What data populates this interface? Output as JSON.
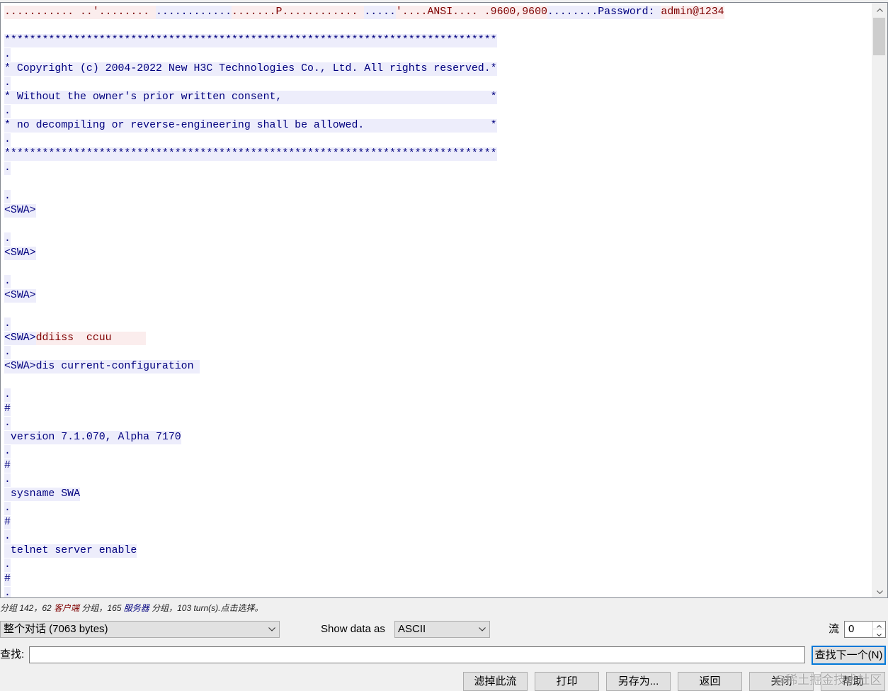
{
  "colors": {
    "client_text": "#7f0000",
    "client_bg": "#fbeded",
    "server_text": "#00007f",
    "server_bg": "#ededfb",
    "accent": "#0078d7"
  },
  "stream": {
    "lines": [
      [
        {
          "client": "........... ..'........ "
        },
        {
          "server": "............"
        },
        {
          "client": ".......P............ "
        },
        {
          "server": "....."
        },
        {
          "client": "'....ANSI.... .9600,9600"
        },
        {
          "server": "........Password: "
        },
        {
          "client": "admin@1234"
        }
      ],
      [],
      [
        {
          "server": "******************************************************************************"
        }
      ],
      [
        {
          "server": "."
        }
      ],
      [
        {
          "server": "* Copyright (c) 2004-2022 New H3C Technologies Co., Ltd. All rights reserved.*"
        }
      ],
      [
        {
          "server": "."
        }
      ],
      [
        {
          "server": "* Without the owner's prior written consent,                                 *"
        }
      ],
      [
        {
          "server": "."
        }
      ],
      [
        {
          "server": "* no decompiling or reverse-engineering shall be allowed.                    *"
        }
      ],
      [
        {
          "server": "."
        }
      ],
      [
        {
          "server": "******************************************************************************"
        }
      ],
      [
        {
          "server": "."
        }
      ],
      [],
      [
        {
          "server": "."
        }
      ],
      [
        {
          "server": "<SWA>"
        }
      ],
      [],
      [
        {
          "server": "."
        }
      ],
      [
        {
          "server": "<SWA>"
        }
      ],
      [],
      [
        {
          "server": "."
        }
      ],
      [
        {
          "server": "<SWA>"
        }
      ],
      [],
      [
        {
          "server": "."
        }
      ],
      [
        {
          "server": "<SWA>"
        },
        {
          "client": "ddiiss  ccuu"
        }
      ],
      [
        {
          "server": "."
        }
      ],
      [
        {
          "server": "<SWA>dis current-configuration "
        }
      ],
      [],
      [
        {
          "server": "."
        }
      ],
      [
        {
          "server": "#"
        }
      ],
      [
        {
          "server": "."
        }
      ],
      [
        {
          "server": " version 7.1.070, Alpha 7170"
        }
      ],
      [
        {
          "server": "."
        }
      ],
      [
        {
          "server": "#"
        }
      ],
      [
        {
          "server": "."
        }
      ],
      [
        {
          "server": " sysname SWA"
        }
      ],
      [
        {
          "server": "."
        }
      ],
      [
        {
          "server": "#"
        }
      ],
      [
        {
          "server": "."
        }
      ],
      [
        {
          "server": " telnet server enable"
        }
      ],
      [
        {
          "server": "."
        }
      ],
      [
        {
          "server": "#"
        }
      ],
      [
        {
          "server": "."
        }
      ]
    ],
    "scroll_icons": {
      "up": "chevron-up-icon",
      "down": "chevron-down-icon"
    }
  },
  "status": {
    "text_1": "分组 142，62 ",
    "client_label": "客户端",
    "text_2": " 分组，165 ",
    "server_label": "服务器",
    "text_3": " 分组，103 turn(s).点击选择。"
  },
  "conversation_select": {
    "value": "整个对话 (7063 bytes)",
    "icon": "chevron-down-icon"
  },
  "show_data_as": {
    "label": "Show data as",
    "value": "ASCII",
    "icon": "chevron-down-icon"
  },
  "stream_index": {
    "label": "流",
    "value": "0"
  },
  "find": {
    "label": "查找:",
    "next_button": "查找下一个(N)"
  },
  "actions": {
    "filter_out": "滤掉此流",
    "print": "打印",
    "save_as": "另存为...",
    "back": "返回",
    "close": "关闭",
    "help": "帮助"
  },
  "watermark": "@稀土掘金技术社区"
}
